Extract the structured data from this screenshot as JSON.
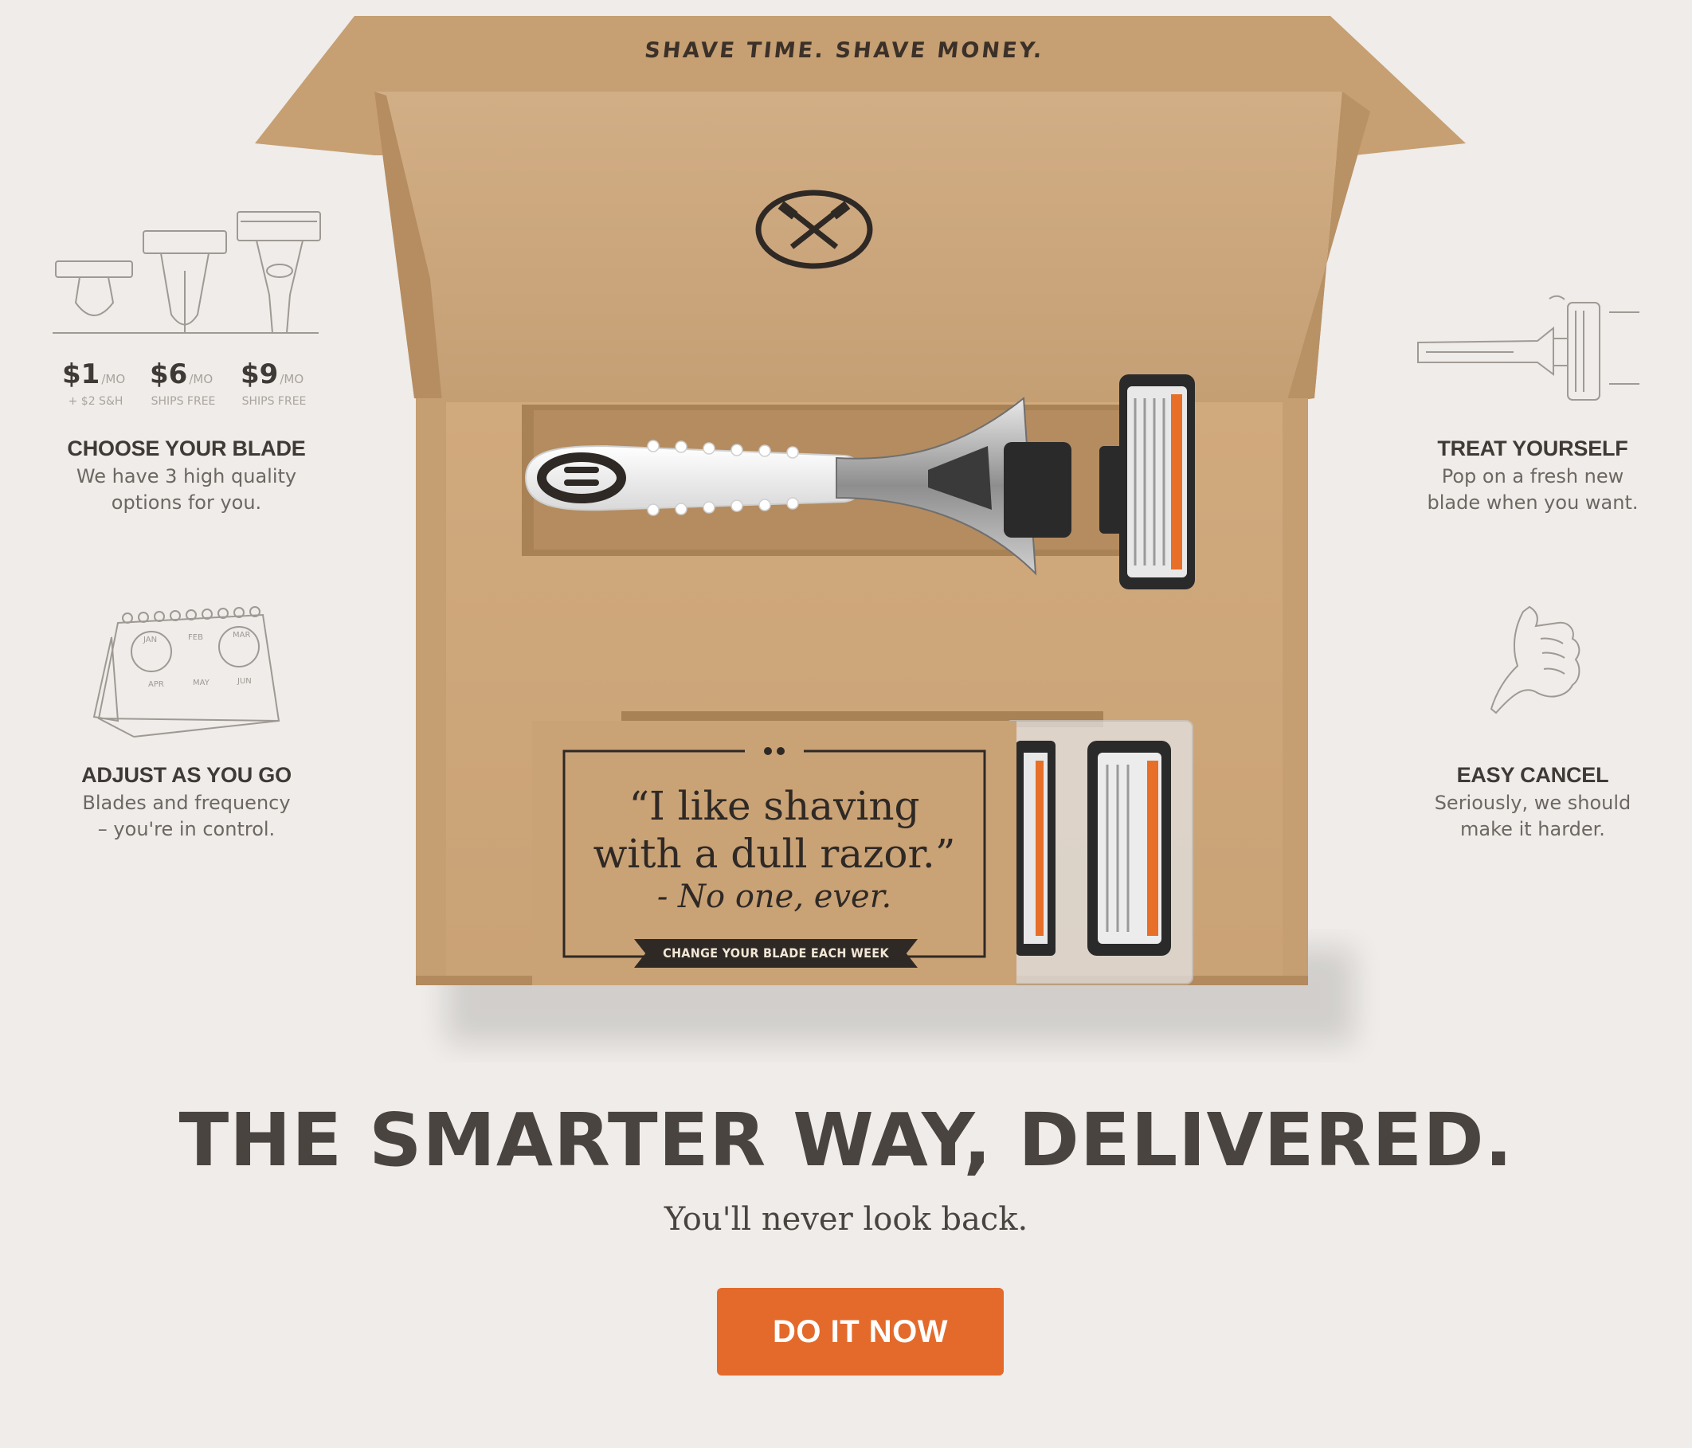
{
  "box": {
    "slogan": "SHAVE TIME. SHAVE MONEY.",
    "quote_line1": "“I like shaving",
    "quote_line2": "with a dull razor.”",
    "quote_author": "- No one, ever.",
    "quote_banner": "CHANGE YOUR BLADE EACH WEEK"
  },
  "features": {
    "choose_blade": {
      "prices": [
        {
          "amount": "$1",
          "unit": "/MO",
          "note": "+ $2 S&H"
        },
        {
          "amount": "$6",
          "unit": "/MO",
          "note": "SHIPS FREE"
        },
        {
          "amount": "$9",
          "unit": "/MO",
          "note": "SHIPS FREE"
        }
      ],
      "title": "CHOOSE YOUR BLADE",
      "desc_line1": "We have 3 high quality",
      "desc_line2": "options for you."
    },
    "adjust": {
      "title": "ADJUST AS YOU GO",
      "desc_line1": "Blades and frequency",
      "desc_line2": "– you're in control.",
      "calendar_months": [
        "JAN",
        "FEB",
        "MAR",
        "APR",
        "MAY",
        "JUN"
      ]
    },
    "treat": {
      "title": "TREAT YOURSELF",
      "desc_line1": "Pop on a fresh new",
      "desc_line2": "blade when you want."
    },
    "cancel": {
      "title": "EASY CANCEL",
      "desc_line1": "Seriously, we should",
      "desc_line2": "make it harder."
    }
  },
  "hero": {
    "headline": "THE SMARTER WAY, DELIVERED.",
    "subhead": "You'll never look back.",
    "cta_label": "DO IT NOW"
  },
  "colors": {
    "background": "#efece9",
    "cardboard": "#c9a47a",
    "accent_orange": "#e36a2b",
    "text_dark": "#4a4440"
  },
  "icons": [
    "razor-lineup-icon",
    "calendar-icon",
    "razor-cartridge-icon",
    "thumbs-up-icon",
    "hammer-logo-icon"
  ]
}
